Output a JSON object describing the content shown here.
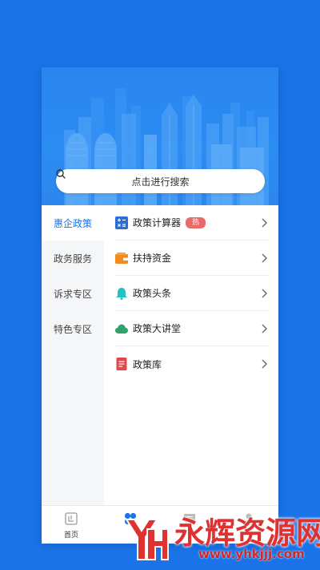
{
  "search": {
    "placeholder": "点击进行搜索"
  },
  "sidebar": {
    "items": [
      {
        "label": "惠企政策",
        "active": true
      },
      {
        "label": "政务服务",
        "active": false
      },
      {
        "label": "诉求专区",
        "active": false
      },
      {
        "label": "特色专区",
        "active": false
      }
    ]
  },
  "list": {
    "items": [
      {
        "label": "政策计算器",
        "icon": "calculator-icon",
        "badge": "热"
      },
      {
        "label": "扶持资金",
        "icon": "wallet-icon"
      },
      {
        "label": "政策头条",
        "icon": "bell-icon"
      },
      {
        "label": "政策大讲堂",
        "icon": "cloud-icon"
      },
      {
        "label": "政策库",
        "icon": "document-icon"
      }
    ]
  },
  "tabbar": {
    "items": [
      {
        "label": "首页",
        "icon": "home-icon"
      },
      {
        "label": "",
        "icon": "apps-icon"
      },
      {
        "label": "",
        "icon": "message-icon"
      },
      {
        "label": "",
        "icon": "user-icon"
      }
    ]
  },
  "watermark": {
    "title": "永辉资源网",
    "url": "www.yhkjjj.com"
  },
  "colors": {
    "background": "#1a73e8",
    "accent": "#1a73e8",
    "hot_badge": "#e86b6b"
  }
}
